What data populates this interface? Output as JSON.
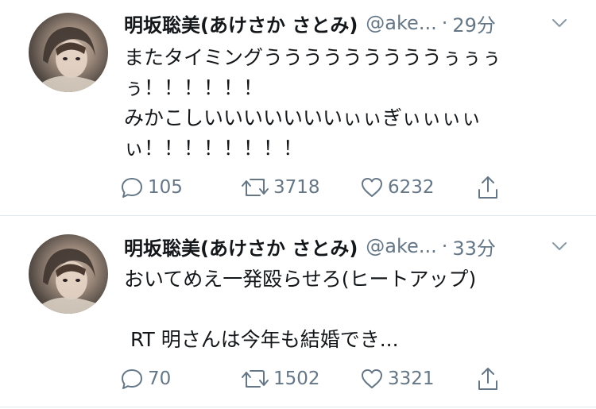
{
  "tweets": [
    {
      "name": "明坂聡美(あけさか さとみ)",
      "handle": "@ake...",
      "separator": "·",
      "time": "29分",
      "text": "またタイミングうううううううううぅぅぅ\nぅ！！！！！！\nみかこしいいいいいいいぃぃぎぃぃぃぃ\nぃ！！！！！！！！",
      "replies": "105",
      "retweets": "3718",
      "likes": "6232"
    },
    {
      "name": "明坂聡美(あけさか さとみ)",
      "handle": "@ake...",
      "separator": "·",
      "time": "33分",
      "text": "おいてめえ一発殴らせろ(ヒートアップ)\n\n RT 明さんは今年も結婚でき...",
      "replies": "70",
      "retweets": "1502",
      "likes": "3321"
    }
  ],
  "colors": {
    "text": "#14171a",
    "secondary": "#657786",
    "divider": "#e1e8ed"
  },
  "icons": [
    "reply-icon",
    "retweet-icon",
    "like-icon",
    "share-icon",
    "chevron-down-icon"
  ]
}
